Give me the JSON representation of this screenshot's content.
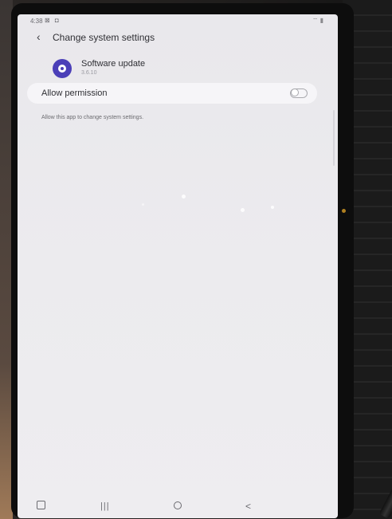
{
  "status_bar": {
    "time": "4:38",
    "left_icons": "⊠ ◘",
    "right_icons": "⌔ ▮"
  },
  "header": {
    "back_icon": "chevron-left-icon",
    "title": "Change system settings"
  },
  "app": {
    "icon": "software-update-icon",
    "icon_color": "#4b3fb8",
    "name": "Software update",
    "version": "3.6.10"
  },
  "permission": {
    "label": "Allow permission",
    "enabled": false
  },
  "description": "Allow this app to change system settings.",
  "nav_bar": {
    "keyboard_icon": "keyboard-icon",
    "recents_icon": "recents-icon",
    "recents_glyph": "|||",
    "home_icon": "home-icon",
    "back_icon": "back-icon",
    "back_glyph": "<"
  }
}
